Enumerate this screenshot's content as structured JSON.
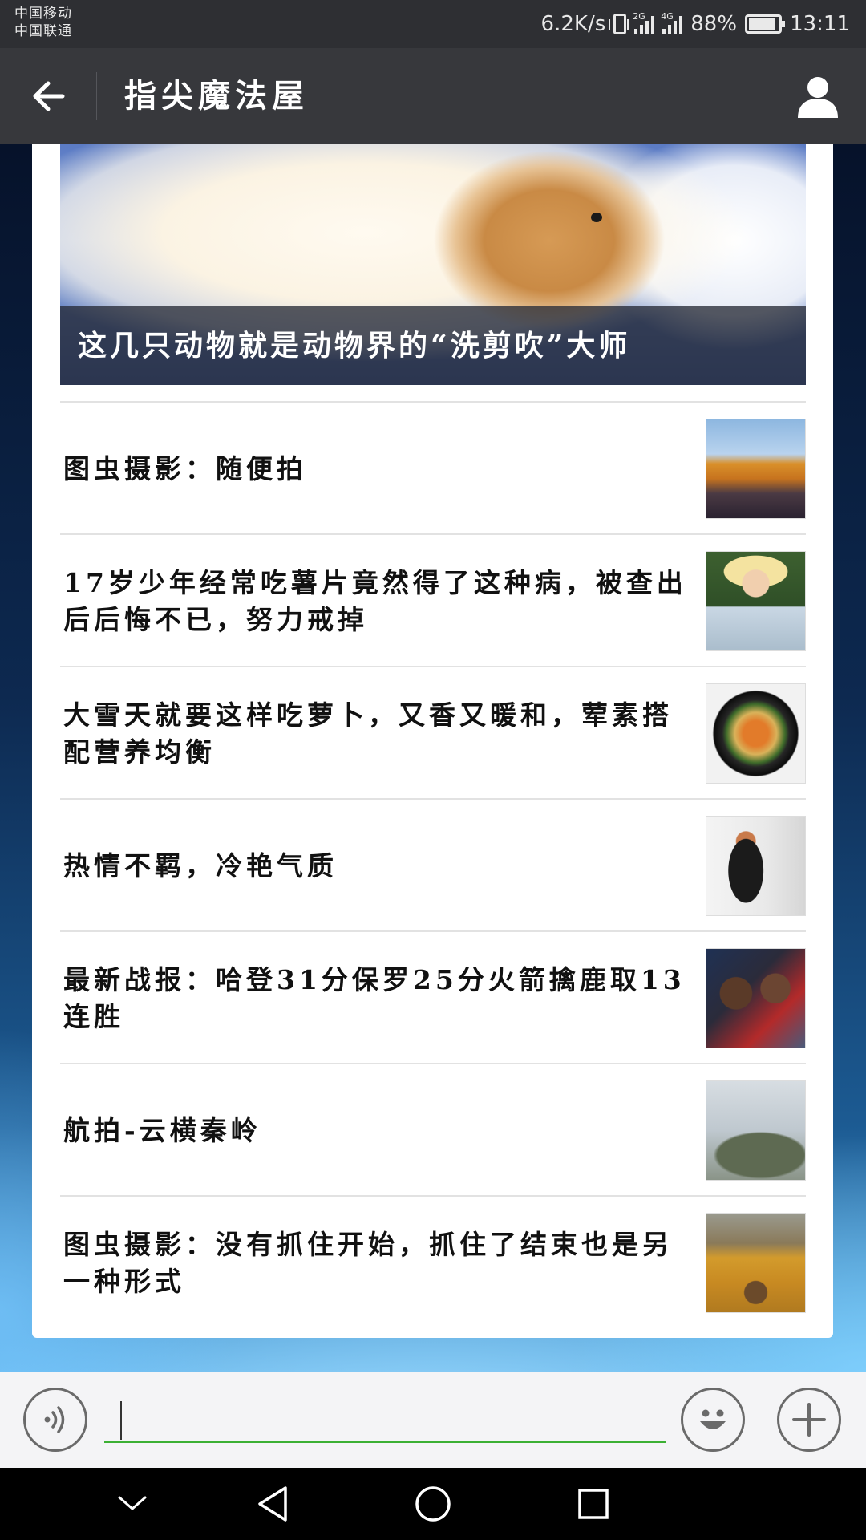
{
  "status_bar": {
    "carrier_1": "中国移动",
    "carrier_2": "中国联通",
    "network_speed": "6.2K/s",
    "net_2g": "2G",
    "net_4g": "4G",
    "battery": "88%",
    "battery_level": 0.88,
    "time": "13:11"
  },
  "title_bar": {
    "title": "指尖魔法屋",
    "back_icon": "arrow-left-icon",
    "profile_icon": "person-icon"
  },
  "hero": {
    "caption": "这几只动物就是动物界的“洗剪吹”大师"
  },
  "news": [
    {
      "title": "图虫摄影：随便拍"
    },
    {
      "title": "17岁少年经常吃薯片竟然得了这种病，被查出后后悔不已，努力戒掉"
    },
    {
      "title": "大雪天就要这样吃萝卜，又香又暖和，荤素搭配营养均衡"
    },
    {
      "title": "热情不羁，冷艳气质"
    },
    {
      "title": "最新战报：哈登31分保罗25分火箭擒鹿取13连胜"
    },
    {
      "title": "航拍-云横秦岭"
    },
    {
      "title": "图虫摄影：没有抓住开始，抓住了结束也是另一种形式"
    }
  ],
  "input_bar": {
    "voice_icon": "voice-icon",
    "emoji_icon": "emoji-icon",
    "plus_icon": "plus-icon",
    "accent_color": "#3cb034"
  },
  "nav_bar": {
    "hide_icon": "chevron-down-icon",
    "back_icon": "triangle-back-icon",
    "home_icon": "circle-home-icon",
    "recent_icon": "square-recent-icon"
  }
}
